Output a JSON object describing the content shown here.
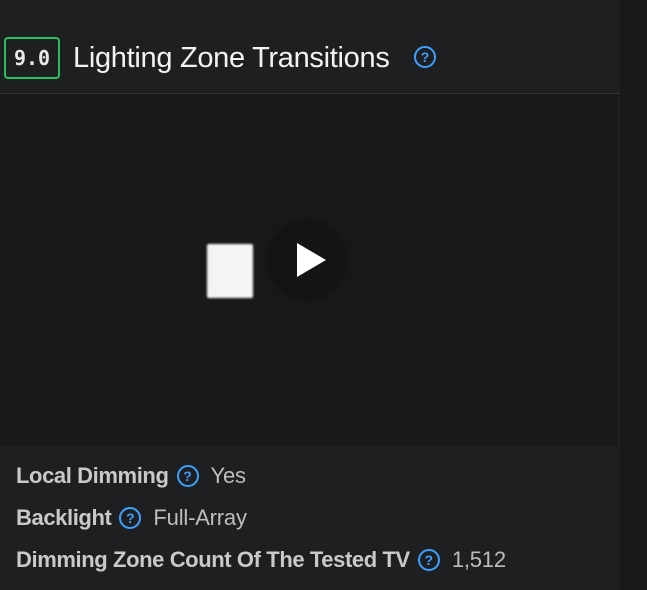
{
  "section": {
    "score": "9.0",
    "title": "Lighting Zone Transitions",
    "help_glyph": "?"
  },
  "video": {
    "state": "paused"
  },
  "specs": [
    {
      "label": "Local Dimming",
      "value": "Yes"
    },
    {
      "label": "Backlight",
      "value": "Full-Array"
    },
    {
      "label": "Dimming Zone Count Of The Tested TV",
      "value": "1,512"
    }
  ],
  "colors": {
    "score_border": "#2bbf5a",
    "help_icon": "#3ea0ff",
    "background": "#1e1f21"
  }
}
